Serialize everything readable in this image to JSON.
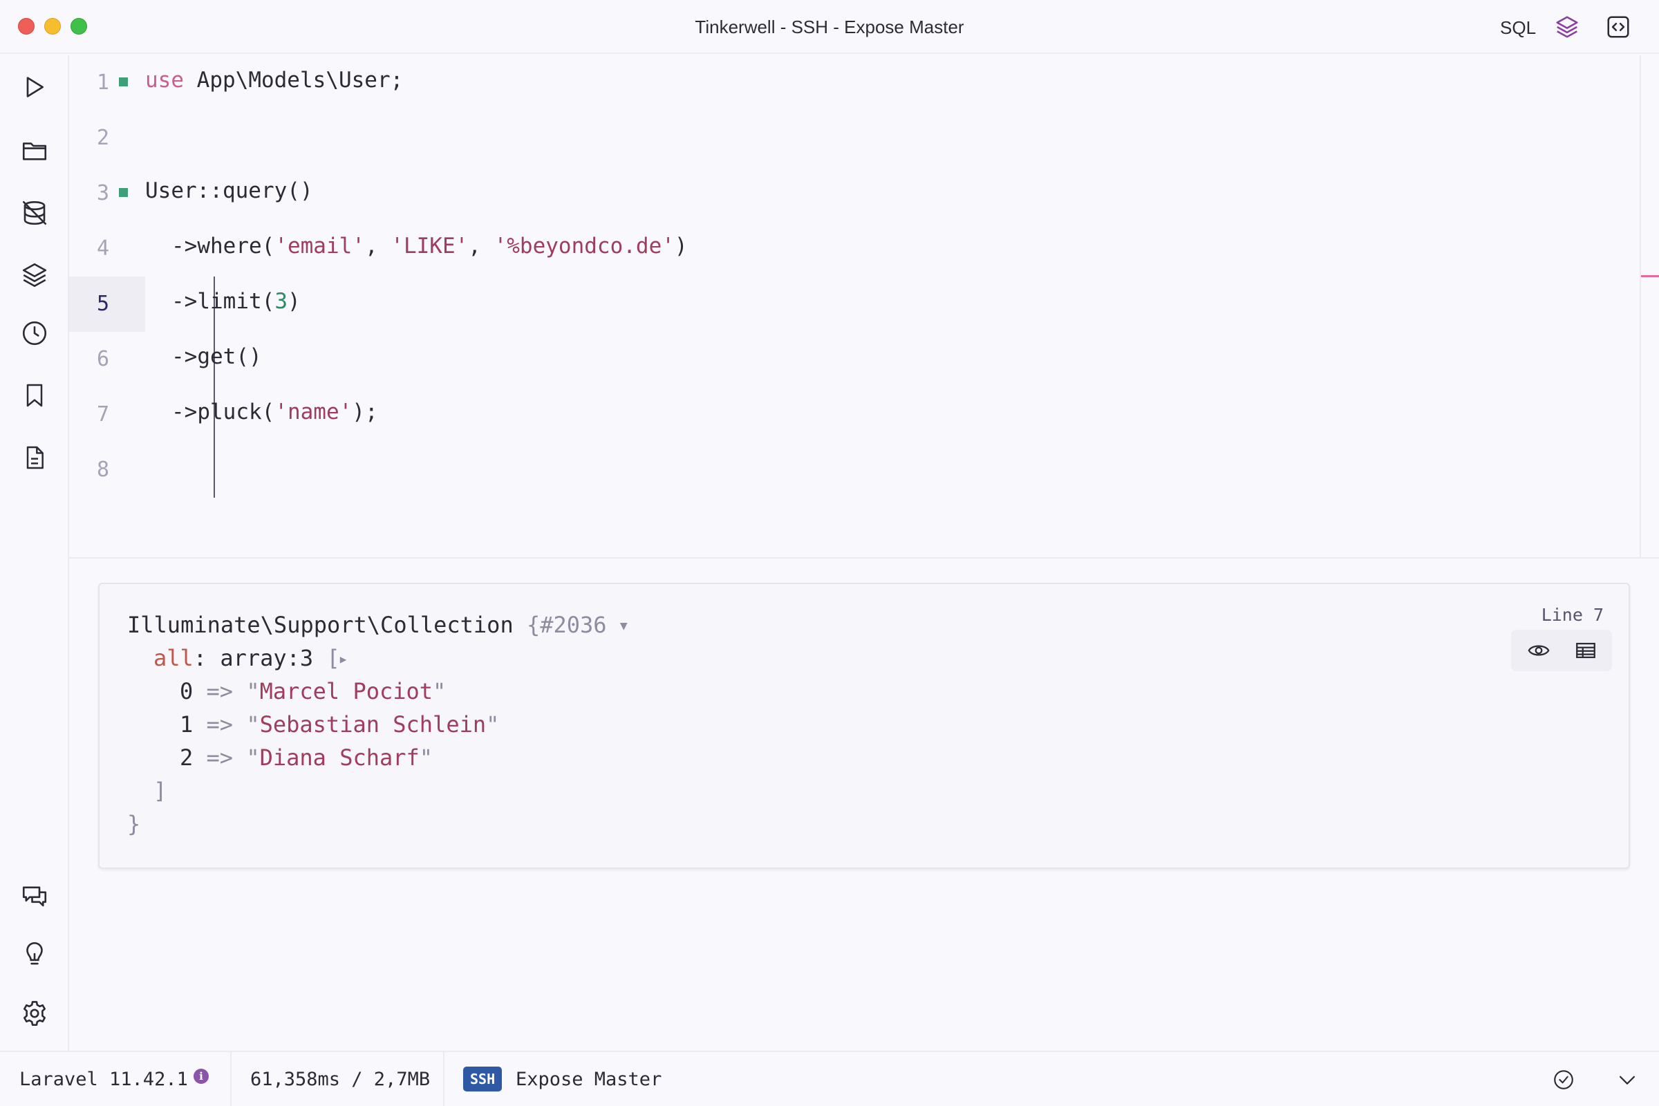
{
  "window": {
    "title": "Tinkerwell - SSH - Expose Master"
  },
  "toolbar": {
    "sql_label": "SQL",
    "layers_icon": "layers-icon",
    "code_icon": "code-brackets-icon"
  },
  "sidebar": {
    "items": [
      {
        "name": "run",
        "icon": "play-icon"
      },
      {
        "name": "open",
        "icon": "folder-icon"
      },
      {
        "name": "database",
        "icon": "database-off-icon"
      },
      {
        "name": "layers",
        "icon": "layers-icon"
      },
      {
        "name": "history",
        "icon": "clock-icon"
      },
      {
        "name": "snippets",
        "icon": "bookmark-icon"
      },
      {
        "name": "document",
        "icon": "document-icon"
      }
    ],
    "bottom_items": [
      {
        "name": "chat",
        "icon": "chat-bubbles-icon"
      },
      {
        "name": "tips",
        "icon": "lightbulb-icon"
      },
      {
        "name": "settings",
        "icon": "gear-icon"
      }
    ]
  },
  "editor": {
    "active_line": 5,
    "lines": [
      {
        "number": "1",
        "fold": true,
        "tokens": [
          {
            "t": "use",
            "c": "kw"
          },
          {
            "t": " App\\Models\\User;",
            "c": ""
          }
        ]
      },
      {
        "number": "2",
        "fold": false,
        "tokens": []
      },
      {
        "number": "3",
        "fold": true,
        "tokens": [
          {
            "t": "User::query()",
            "c": ""
          }
        ]
      },
      {
        "number": "4",
        "fold": false,
        "indent": true,
        "tokens": [
          {
            "t": "->where(",
            "c": ""
          },
          {
            "t": "'email'",
            "c": "str"
          },
          {
            "t": ", ",
            "c": ""
          },
          {
            "t": "'LIKE'",
            "c": "str"
          },
          {
            "t": ", ",
            "c": ""
          },
          {
            "t": "'%beyondco.de'",
            "c": "str"
          },
          {
            "t": ")",
            "c": ""
          }
        ]
      },
      {
        "number": "5",
        "fold": false,
        "indent": true,
        "tokens": [
          {
            "t": "->limit(",
            "c": ""
          },
          {
            "t": "3",
            "c": "num"
          },
          {
            "t": ")",
            "c": ""
          }
        ]
      },
      {
        "number": "6",
        "fold": false,
        "indent": true,
        "tokens": [
          {
            "t": "->get()",
            "c": ""
          }
        ]
      },
      {
        "number": "7",
        "fold": false,
        "indent": true,
        "tokens": [
          {
            "t": "->pluck(",
            "c": ""
          },
          {
            "t": "'name'",
            "c": "str"
          },
          {
            "t": ");",
            "c": ""
          }
        ]
      },
      {
        "number": "8",
        "fold": false,
        "tokens": []
      }
    ]
  },
  "output": {
    "line_label": "Line 7",
    "class_name": "Illuminate\\Support\\Collection",
    "brace_open": "{",
    "object_id": "#2036",
    "prop_name": "all",
    "prop_sep": ": ",
    "prop_type": "array:3",
    "bracket_open": "[",
    "items": [
      {
        "index": "0",
        "arrow": "=>",
        "value": "Marcel Pociot"
      },
      {
        "index": "1",
        "arrow": "=>",
        "value": "Sebastian Schlein"
      },
      {
        "index": "2",
        "arrow": "=>",
        "value": "Diana Scharf"
      }
    ],
    "bracket_close": "]",
    "brace_close": "}",
    "tools": {
      "view_icon": "eye-icon",
      "table_icon": "table-icon"
    }
  },
  "statusbar": {
    "framework": "Laravel 11.42.1",
    "timing": "61,358ms / 2,7MB",
    "connection_badge": "SSH",
    "connection_name": "Expose Master",
    "status_icon": "check-circle-icon",
    "collapse_icon": "chevron-down-icon"
  },
  "colors": {
    "keyword": "#c8608f",
    "string": "#a03c5e",
    "number": "#2f8a62",
    "fold_marker": "#3fa078",
    "ssh_badge": "#2e5aa5",
    "info_dot": "#8a55a8"
  }
}
